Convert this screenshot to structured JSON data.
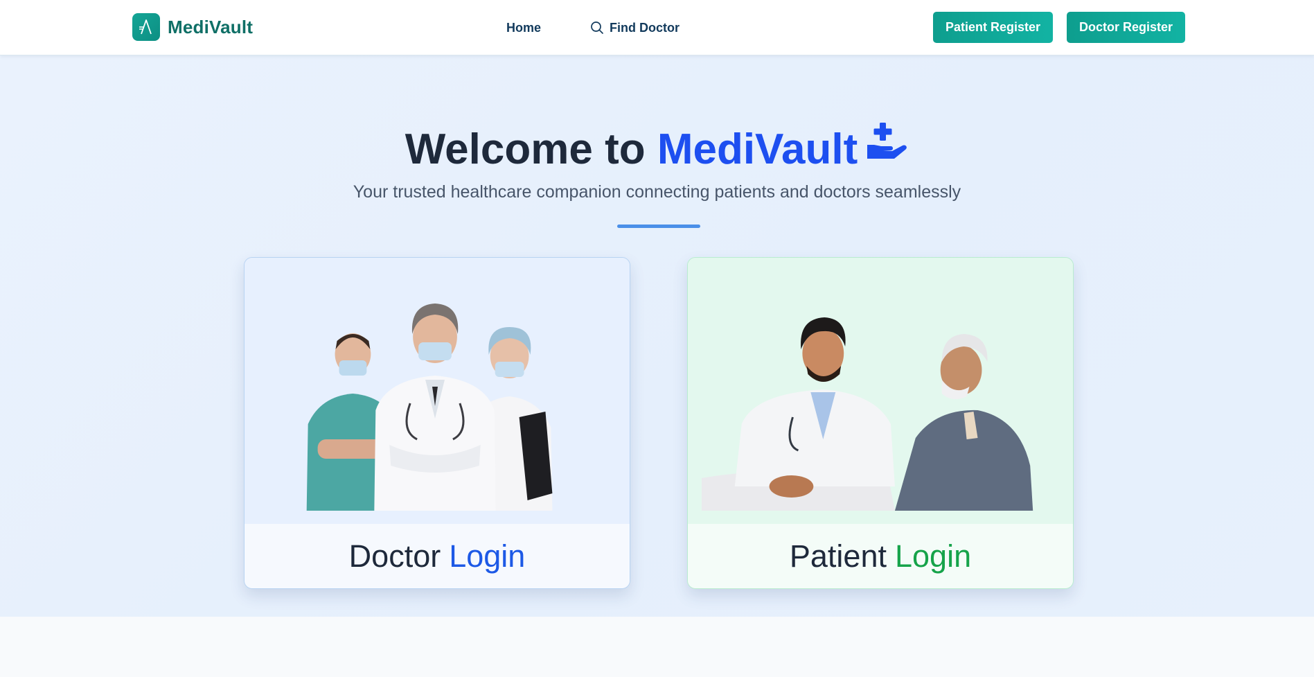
{
  "navbar": {
    "brand": "MediVault",
    "links": [
      {
        "label": "Home"
      },
      {
        "label": "Find Doctor",
        "icon": "search-icon"
      }
    ],
    "buttons": {
      "patient_register": "Patient Register",
      "doctor_register": "Doctor Register"
    }
  },
  "hero": {
    "title_prefix": "Welcome to",
    "title_accent": "MediVault",
    "title_icon": "hand-holding-medical-icon",
    "subtitle": "Your trusted healthcare companion connecting patients and doctors seamlessly"
  },
  "cards": {
    "doctor": {
      "word": "Doctor",
      "action": "Login",
      "image": "doctors-group-photo"
    },
    "patient": {
      "word": "Patient",
      "action": "Login",
      "image": "doctor-patient-consultation-photo"
    }
  },
  "colors": {
    "brand_teal": "#0f8c80",
    "accent_blue": "#1d4ff0",
    "accent_green": "#16a34a",
    "text_dark": "#1e293b"
  }
}
